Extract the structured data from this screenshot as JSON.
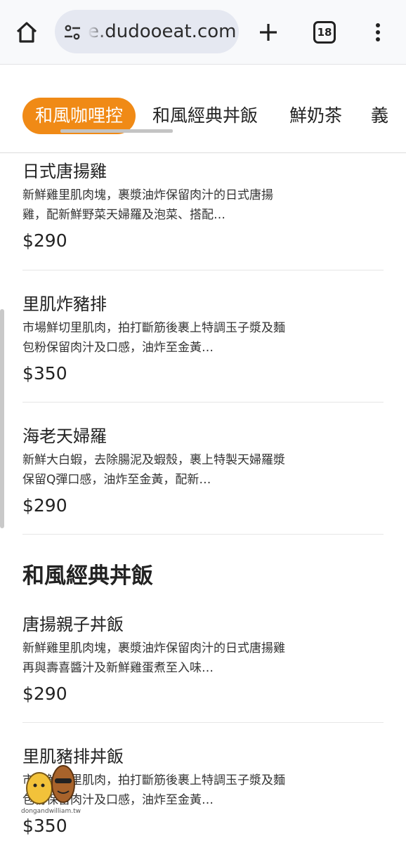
{
  "browser": {
    "url": "e.dudooeat.com",
    "tab_count": "18"
  },
  "categories": {
    "tabs": [
      "和風咖哩控",
      "和風經典丼飯",
      "鮮奶茶",
      "義"
    ]
  },
  "menu": {
    "items": [
      {
        "name": "日式唐揚雞",
        "desc": "新鮮雞里肌肉塊，裹漿油炸保留肉汁的日式唐揚雞，配新鮮野菜天婦羅及泡菜、搭配…",
        "price": "$290"
      },
      {
        "name": "里肌炸豬排",
        "desc": "市場鮮切里肌肉，拍打斷筋後裹上特調玉子漿及麵包粉保留肉汁及口感，油炸至金黃…",
        "price": "$350"
      },
      {
        "name": "海老天婦羅",
        "desc": "新鮮大白蝦，去除腸泥及蝦殼，裹上特製天婦羅漿保留Q彈口感，油炸至金黃，配新…",
        "price": "$290"
      }
    ],
    "section2": {
      "title": "和風經典丼飯",
      "items": [
        {
          "name": "唐揚親子丼飯",
          "desc": "新鮮雞里肌肉塊，裹漿油炸保留肉汁的日式唐揚雞再與壽喜醬汁及新鮮雞蛋煮至入味…",
          "price": "$290"
        },
        {
          "name": "里肌豬排丼飯",
          "desc": "市場鮮切里肌肉，拍打斷筋後裹上特調玉子漿及麵包粉保留肉汁及口感，油炸至金黃…",
          "price": "$350"
        }
      ]
    }
  },
  "watermark": {
    "text": "dongandwilliam.tw"
  },
  "colors": {
    "accent": "#f08a16"
  },
  "icons": [
    "home-icon",
    "site-settings-icon",
    "plus-icon",
    "tabs-icon",
    "more-vert-icon"
  ]
}
